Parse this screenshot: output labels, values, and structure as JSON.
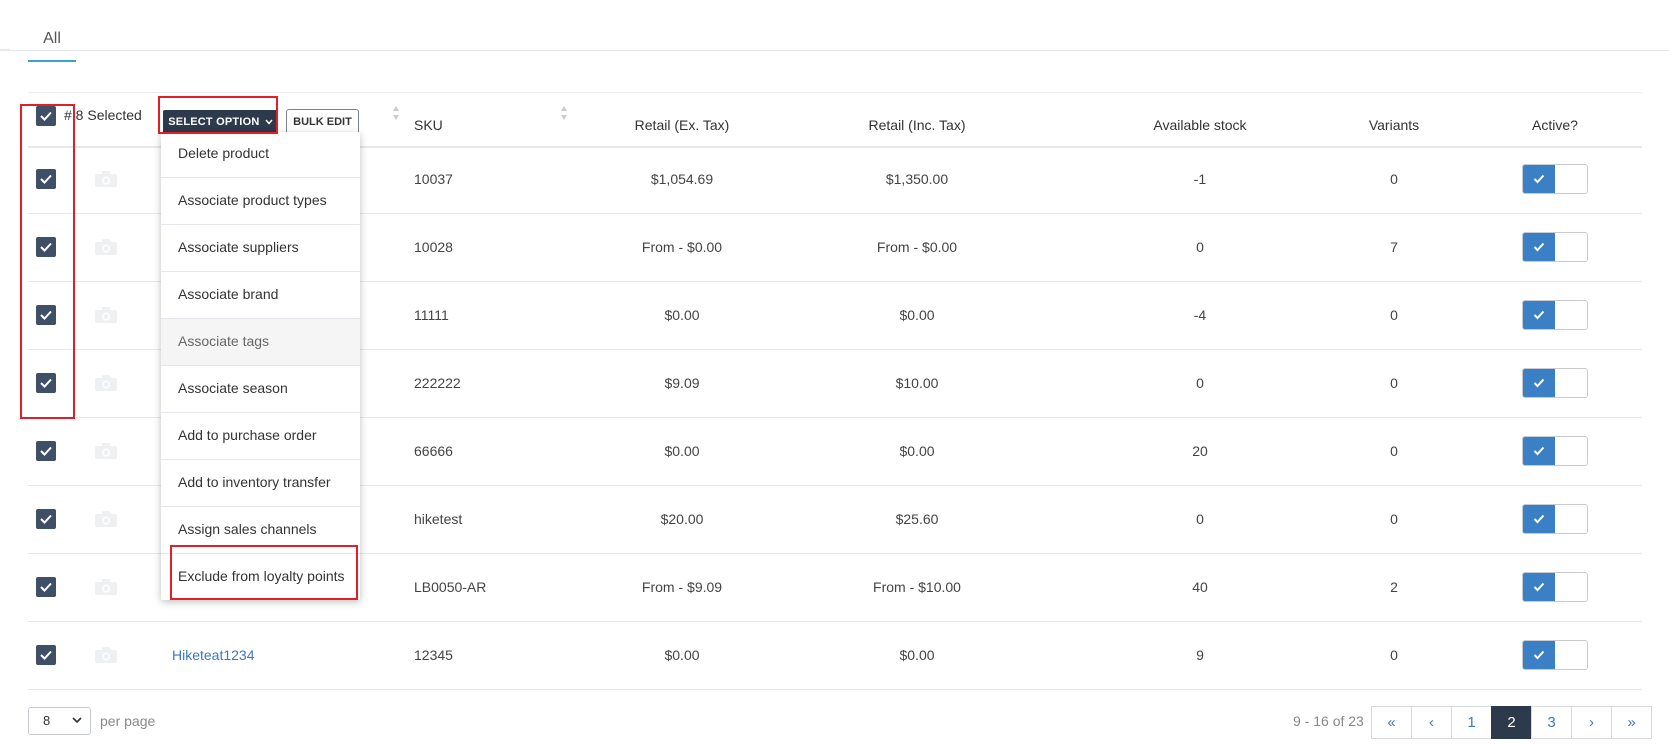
{
  "tabs": {
    "all_label": "All"
  },
  "header": {
    "selected_label": "# 8 Selected",
    "select_option_label": "SELECT OPTION",
    "bulk_edit_label": "BULK EDIT",
    "columns": {
      "sku": "SKU",
      "retail_ex": "Retail (Ex. Tax)",
      "retail_inc": "Retail (Inc. Tax)",
      "stock": "Available stock",
      "variants": "Variants",
      "active": "Active?"
    }
  },
  "dropdown": {
    "items": [
      "Delete product",
      "Associate product types",
      "Associate suppliers",
      "Associate brand",
      "Associate tags",
      "Associate season",
      "Add to purchase order",
      "Add to inventory transfer",
      "Assign sales channels",
      "Exclude from loyalty points"
    ]
  },
  "rows": [
    {
      "name": "",
      "sku": "10037",
      "retail_ex": "$1,054.69",
      "retail_inc": "$1,350.00",
      "stock": "-1",
      "variants": "0",
      "active": true
    },
    {
      "name": "",
      "sku": "10028",
      "retail_ex": "From - $0.00",
      "retail_inc": "From - $0.00",
      "stock": "0",
      "variants": "7",
      "active": true
    },
    {
      "name": "",
      "sku": "11111",
      "retail_ex": "$0.00",
      "retail_inc": "$0.00",
      "stock": "-4",
      "variants": "0",
      "active": true
    },
    {
      "name": "",
      "sku": "222222",
      "retail_ex": "$9.09",
      "retail_inc": "$10.00",
      "stock": "0",
      "variants": "0",
      "active": true
    },
    {
      "name": "",
      "sku": "66666",
      "retail_ex": "$0.00",
      "retail_inc": "$0.00",
      "stock": "20",
      "variants": "0",
      "active": true
    },
    {
      "name": "",
      "sku": "hiketest",
      "retail_ex": "$20.00",
      "retail_inc": "$25.60",
      "stock": "0",
      "variants": "0",
      "active": true
    },
    {
      "name": "",
      "sku": "LB0050-AR",
      "retail_ex": "From - $9.09",
      "retail_inc": "From - $10.00",
      "stock": "40",
      "variants": "2",
      "active": true
    },
    {
      "name": "Hiketeat1234",
      "sku": "12345",
      "retail_ex": "$0.00",
      "retail_inc": "$0.00",
      "stock": "9",
      "variants": "0",
      "active": true
    }
  ],
  "footer": {
    "per_page_value": "8",
    "per_page_label": "per page",
    "range_text": "9 - 16 of 23",
    "pages": [
      "«",
      "‹",
      "1",
      "2",
      "3",
      "›",
      "»"
    ],
    "current_page": "2"
  },
  "colors": {
    "accent": "#3b7fc4",
    "dark": "#2d3a4b",
    "highlight": "#e41e26",
    "checkbox": "#3f4f66"
  },
  "icons": {
    "checkbox": "check-icon",
    "image": "camera-icon",
    "dropdown": "chevron-down-icon",
    "sort": "sort-icon"
  }
}
